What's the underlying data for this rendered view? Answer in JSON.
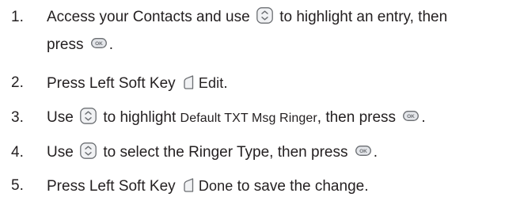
{
  "steps": [
    {
      "number": "1.",
      "part1": "Access your Contacts and use",
      "part2": "to highlight an entry, then",
      "part3": "press",
      "part4": "."
    },
    {
      "number": "2.",
      "part1": "Press Left Soft Key",
      "part2": "Edit",
      "part3": "."
    },
    {
      "number": "3.",
      "part1": "Use",
      "part2": "to highlight",
      "part3": "Default TXT Msg Ringer",
      "part4": ", then press",
      "part5": "."
    },
    {
      "number": "4.",
      "part1": "Use",
      "part2": "to select the Ringer Type, then press",
      "part3": "."
    },
    {
      "number": "5.",
      "part1": "Press Left Soft Key",
      "part2": "Done",
      "part3": "to save the change."
    }
  ],
  "icons": {
    "navigation_key": "nav-key-icon",
    "ok_key": "ok-key-icon",
    "left_soft_key": "left-soft-key-icon",
    "ok_label": "OK"
  },
  "colors": {
    "text": "#231f20",
    "icon_stroke": "#6b6e72",
    "icon_fill": "#e4e6ea"
  }
}
